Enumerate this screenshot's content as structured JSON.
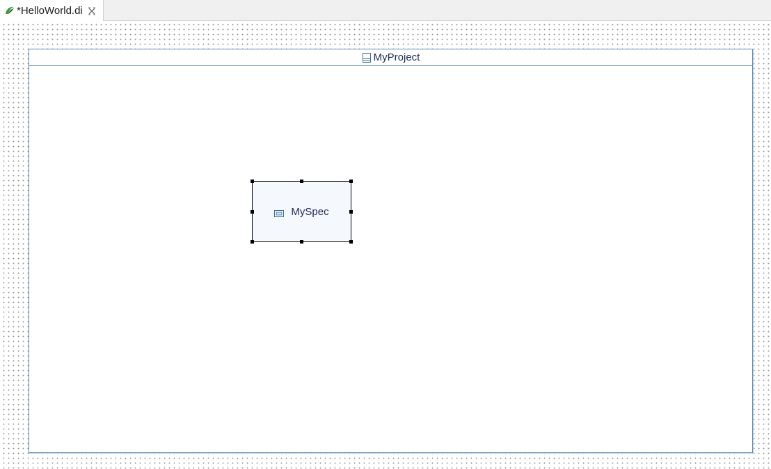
{
  "editor_tab": {
    "title": "*HelloWorld.di",
    "logo_icon": "papyrus-logo-icon",
    "close_icon": "close-icon"
  },
  "diagram": {
    "project": {
      "title": "MyProject",
      "icon": "project-icon"
    },
    "spec": {
      "title": "MySpec",
      "icon": "spec-icon",
      "selected": true
    }
  },
  "colors": {
    "container_border": "#5a8ab5",
    "node_fill": "#f5f8fc",
    "label_text": "#1f2a55",
    "grid_dot": "#9a9a9a"
  }
}
